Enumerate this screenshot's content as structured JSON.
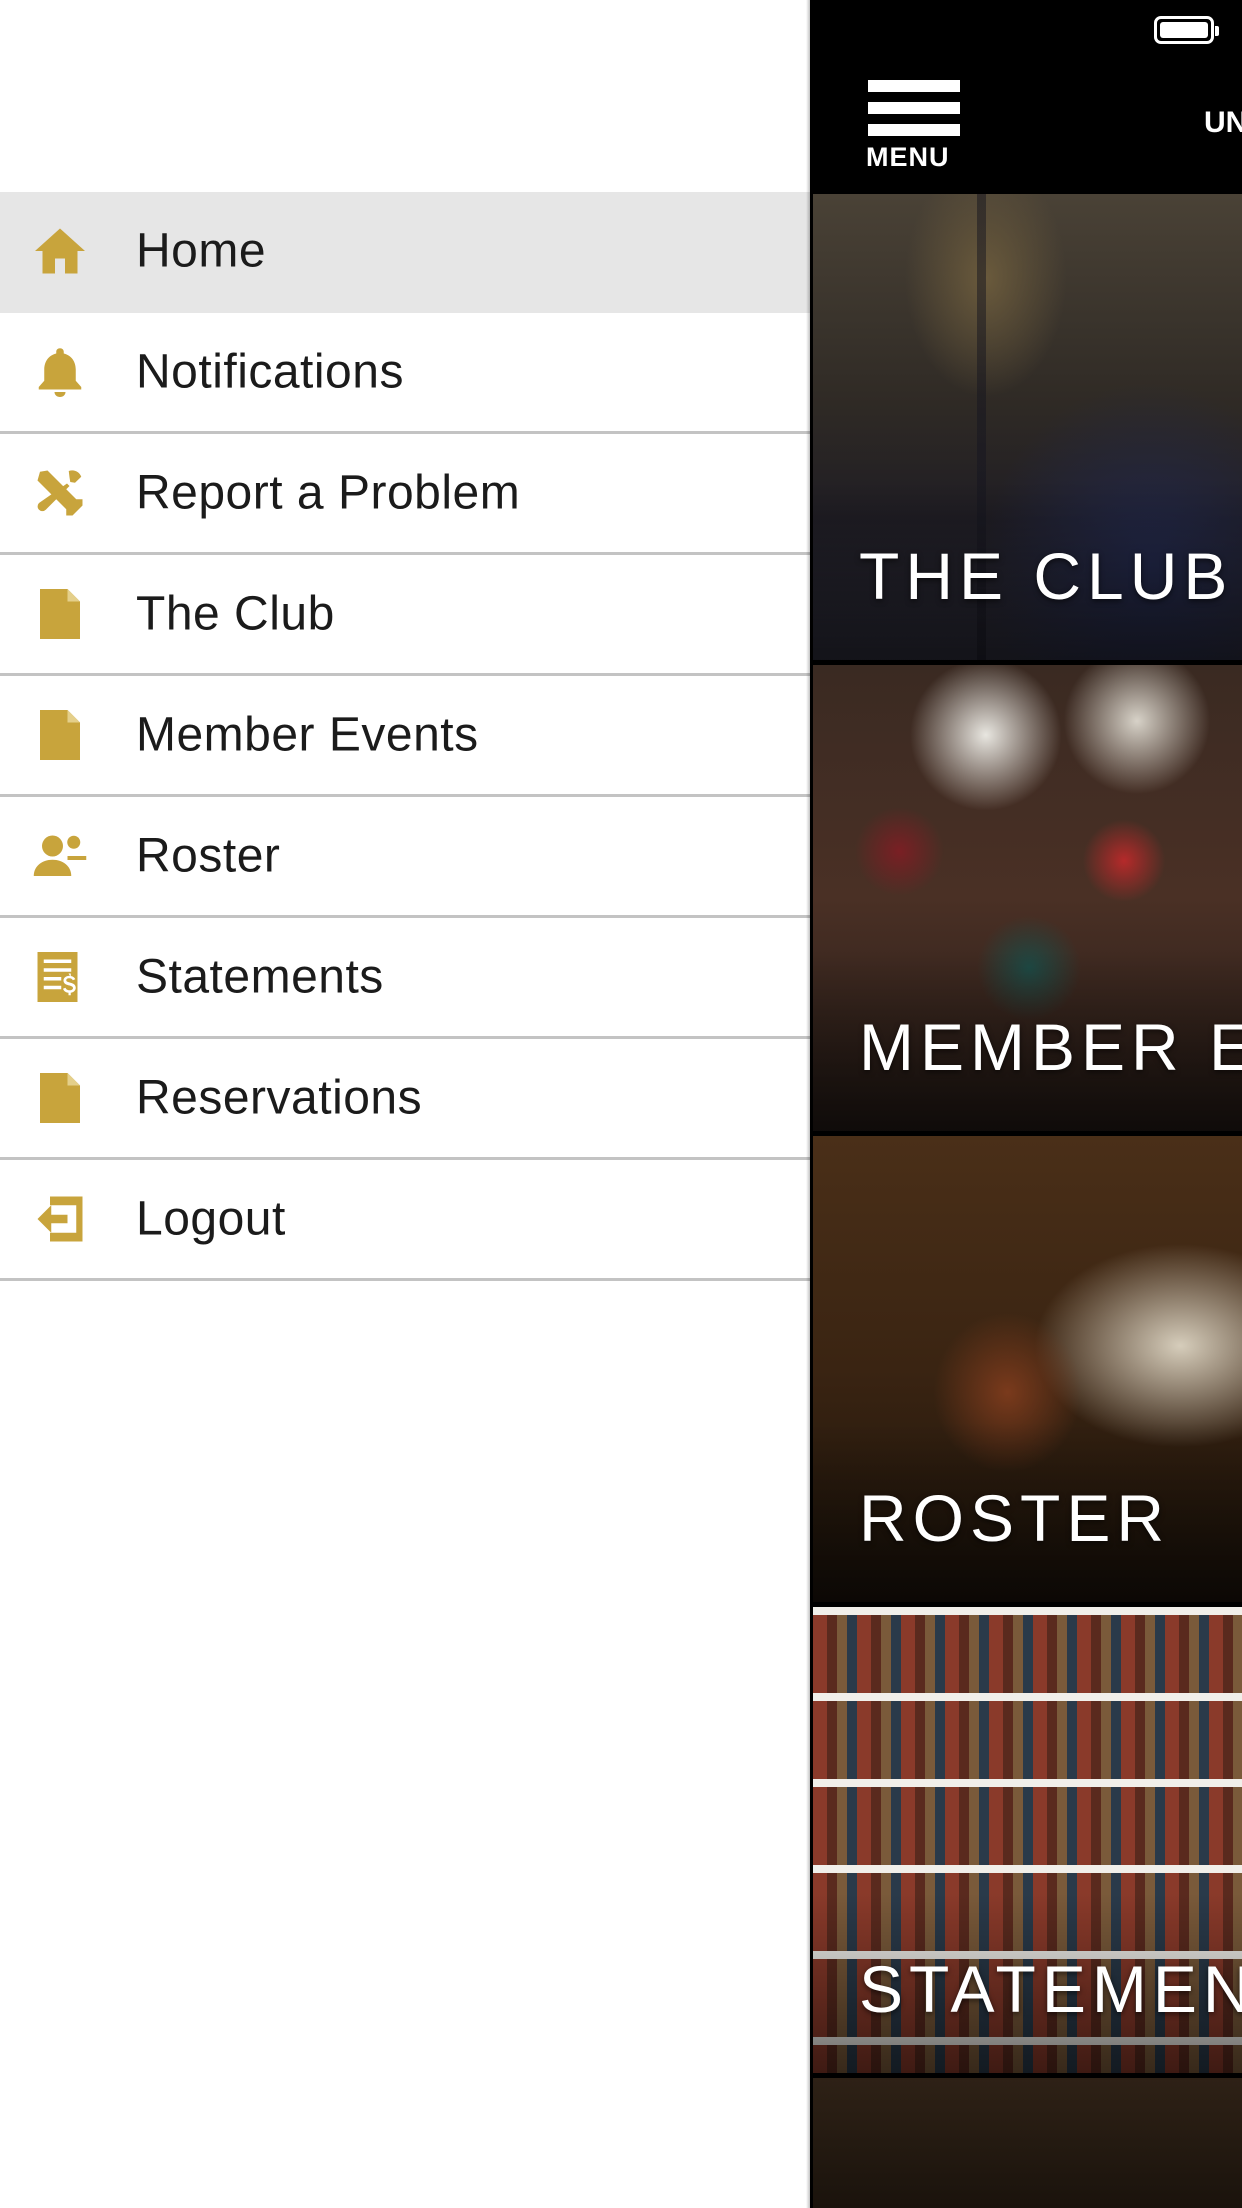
{
  "drawer": {
    "items": [
      {
        "label": "Home",
        "icon": "home-icon",
        "active": true
      },
      {
        "label": "Notifications",
        "icon": "bell-icon",
        "active": false
      },
      {
        "label": "Report a Problem",
        "icon": "tools-icon",
        "active": false
      },
      {
        "label": "The Club",
        "icon": "document-icon",
        "active": false
      },
      {
        "label": "Member Events",
        "icon": "document-icon",
        "active": false
      },
      {
        "label": "Roster",
        "icon": "person-icon",
        "active": false
      },
      {
        "label": "Statements",
        "icon": "statement-icon",
        "active": false
      },
      {
        "label": "Reservations",
        "icon": "document-icon",
        "active": false
      },
      {
        "label": "Logout",
        "icon": "logout-icon",
        "active": false
      }
    ]
  },
  "header": {
    "menu_label": "MENU",
    "title_fragment": "UN"
  },
  "tiles": [
    {
      "label": "THE CLUB"
    },
    {
      "label": "MEMBER EVENTS"
    },
    {
      "label": "ROSTER"
    },
    {
      "label": "STATEMENTS"
    },
    {
      "label": ""
    }
  ],
  "colors": {
    "accent": "#c8a43c",
    "active_row": "#e6e6e6",
    "divider": "#c3c3c3",
    "header_bg": "#000000"
  }
}
